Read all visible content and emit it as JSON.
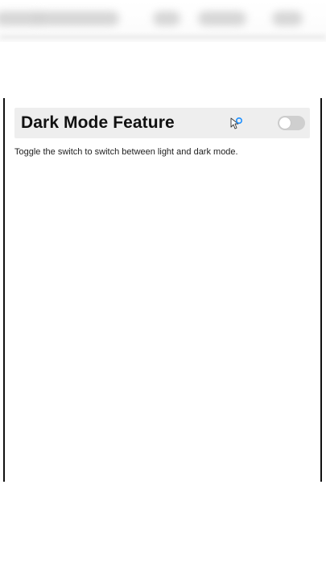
{
  "page": {
    "title": "Dark Mode Feature",
    "description": "Toggle the switch to switch between light and dark mode."
  },
  "toggle": {
    "state": "off",
    "track_color": "#cfcfcf",
    "knob_color": "#ffffff"
  },
  "icons": {
    "cursor": "mouse-pointer-with-click-indicator"
  },
  "colors": {
    "header_background": "#eeeeee",
    "frame_border": "#111111",
    "cursor_accent": "#1e90ff"
  }
}
